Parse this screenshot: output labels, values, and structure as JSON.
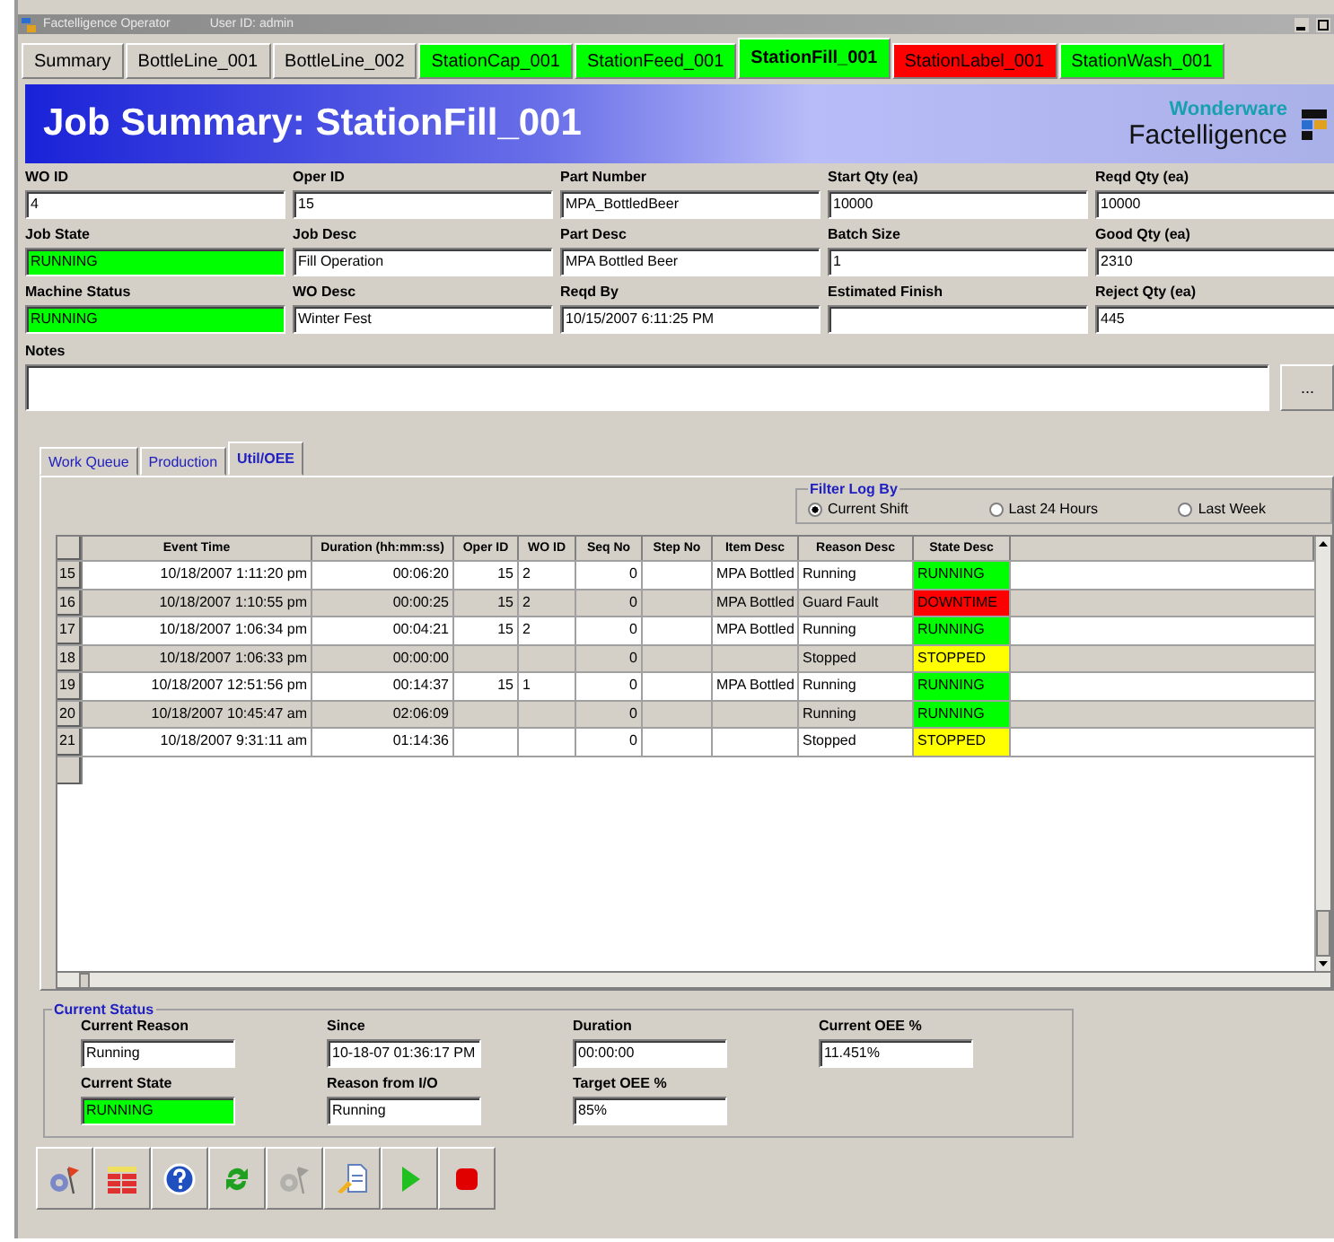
{
  "window": {
    "title": "Factelligence Operator",
    "user": "User ID: admin"
  },
  "tabs": [
    {
      "label": "Summary",
      "selected": false,
      "color": "#d4d0c8"
    },
    {
      "label": "BottleLine_001",
      "selected": false,
      "color": "#d4d0c8"
    },
    {
      "label": "BottleLine_002",
      "selected": false,
      "color": "#d4d0c8"
    },
    {
      "label": "StationCap_001",
      "selected": false,
      "color": "#00ff00"
    },
    {
      "label": "StationFeed_001",
      "selected": false,
      "color": "#00ff00"
    },
    {
      "label": "StationFill_001",
      "selected": true,
      "color": "#00ff00"
    },
    {
      "label": "StationLabel_001",
      "selected": false,
      "color": "#ff0000"
    },
    {
      "label": "StationWash_001",
      "selected": false,
      "color": "#00ff00"
    }
  ],
  "banner": {
    "title": "Job Summary: StationFill_001",
    "brand_top": "Wonderware",
    "brand_bottom": "Factelligence"
  },
  "fields": [
    [
      {
        "label": "WO ID",
        "value": "4"
      },
      {
        "label": "Oper ID",
        "value": "15"
      },
      {
        "label": "Part Number",
        "value": "MPA_BottledBeer"
      },
      {
        "label": "Start Qty (ea)",
        "value": "10000"
      },
      {
        "label": "Reqd Qty (ea)",
        "value": "10000"
      }
    ],
    [
      {
        "label": "Job State",
        "value": "RUNNING",
        "color": "#00ff00"
      },
      {
        "label": "Job Desc",
        "value": "Fill Operation"
      },
      {
        "label": "Part Desc",
        "value": "MPA Bottled Beer"
      },
      {
        "label": "Batch Size",
        "value": "1"
      },
      {
        "label": "Good Qty (ea)",
        "value": "2310"
      }
    ],
    [
      {
        "label": "Machine Status",
        "value": "RUNNING",
        "color": "#00ff00"
      },
      {
        "label": "WO Desc",
        "value": "Winter Fest"
      },
      {
        "label": "Reqd By",
        "value": "10/15/2007 6:11:25 PM"
      },
      {
        "label": "Estimated Finish"
      },
      {
        "label": "Reject Qty (ea)",
        "value": "445"
      }
    ]
  ],
  "notes": {
    "label": "Notes",
    "button": "..."
  },
  "sub_tabs": [
    {
      "label": "Work Queue",
      "selected": false
    },
    {
      "label": "Production",
      "selected": false
    },
    {
      "label": "Util/OEE",
      "selected": true
    }
  ],
  "filter": {
    "title": "Filter Log By",
    "options": [
      {
        "label": "Current Shift",
        "selected": true
      },
      {
        "label": "Last 24 Hours",
        "selected": false
      },
      {
        "label": "Last Week",
        "selected": false
      }
    ]
  },
  "table": {
    "columns": [
      "Event Time",
      "Duration (hh:mm:ss)",
      "Oper ID",
      "WO ID",
      "Seq No",
      "Step No",
      "Item Desc",
      "Reason Desc",
      "State Desc"
    ],
    "rows": [
      {
        "num": "15",
        "cells": [
          "10/18/2007 1:11:20 pm",
          "00:06:20",
          "15",
          "2",
          "0",
          "",
          "MPA Bottled",
          "Running",
          "RUNNING"
        ],
        "color": "#00ff00"
      },
      {
        "num": "16",
        "cells": [
          "10/18/2007 1:10:55 pm",
          "00:00:25",
          "15",
          "2",
          "0",
          "",
          "MPA Bottled",
          "Guard Fault",
          "DOWNTIME"
        ],
        "color": "#ff0000"
      },
      {
        "num": "17",
        "cells": [
          "10/18/2007 1:06:34 pm",
          "00:04:21",
          "15",
          "2",
          "0",
          "",
          "MPA Bottled",
          "Running",
          "RUNNING"
        ],
        "color": "#00ff00"
      },
      {
        "num": "18",
        "cells": [
          "10/18/2007 1:06:33 pm",
          "00:00:00",
          "",
          "",
          "0",
          "",
          "",
          "Stopped",
          "STOPPED"
        ],
        "color": "#ffff00"
      },
      {
        "num": "19",
        "cells": [
          "10/18/2007 12:51:56 pm",
          "00:14:37",
          "15",
          "1",
          "0",
          "",
          "MPA Bottled",
          "Running",
          "RUNNING"
        ],
        "color": "#00ff00"
      },
      {
        "num": "20",
        "cells": [
          "10/18/2007 10:45:47 am",
          "02:06:09",
          "",
          "",
          "0",
          "",
          "",
          "Running",
          "RUNNING"
        ],
        "color": "#00ff00"
      },
      {
        "num": "21",
        "cells": [
          "10/18/2007 9:31:11 am",
          "01:14:36",
          "",
          "",
          "0",
          "",
          "",
          "Stopped",
          "STOPPED"
        ],
        "color": "#ffff00"
      }
    ]
  },
  "current_status": {
    "title": "Current Status",
    "fields": [
      {
        "label": "Current Reason",
        "value": "Running"
      },
      {
        "label": "Since",
        "value": "10-18-07 01:36:17 PM"
      },
      {
        "label": "Duration",
        "value": "00:00:00"
      },
      {
        "label": "Current OEE %",
        "value": "11.451%"
      },
      {
        "label": "Current State",
        "value": "RUNNING",
        "color": "#00ff00"
      },
      {
        "label": "Reason from I/O",
        "value": "Running"
      },
      {
        "label": "Target OEE %",
        "value": "85%"
      }
    ]
  },
  "toolbar": [
    {
      "kind": "gearflag",
      "disabled": false
    },
    {
      "kind": "table",
      "disabled": false
    },
    {
      "kind": "help",
      "disabled": false
    },
    {
      "kind": "refresh",
      "disabled": false
    },
    {
      "kind": "gearflag",
      "disabled": true
    },
    {
      "kind": "doc",
      "disabled": false
    },
    {
      "kind": "play",
      "disabled": false
    },
    {
      "kind": "stop",
      "disabled": false
    }
  ]
}
